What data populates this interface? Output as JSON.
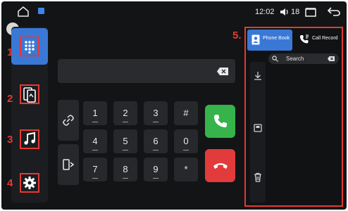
{
  "status_bar": {
    "time": "12:02",
    "volume": "18"
  },
  "callouts": [
    "1",
    "2",
    "3",
    "4",
    "5."
  ],
  "sidebar": {
    "items": [
      {
        "id": "dialpad",
        "icon": "dialpad-icon",
        "active": true
      },
      {
        "id": "phone-link",
        "icon": "phone-link-icon",
        "active": false
      },
      {
        "id": "music",
        "icon": "music-note-icon",
        "active": false
      },
      {
        "id": "settings",
        "icon": "gear-icon",
        "active": false
      }
    ]
  },
  "dialer": {
    "display_value": "",
    "keys": [
      "1",
      "2",
      "3",
      "#",
      "4",
      "5",
      "6",
      "0",
      "7",
      "8",
      "9",
      "*"
    ],
    "utility": [
      "link-icon",
      "phone-transfer-icon"
    ],
    "call_color": "#36b34b",
    "end_color": "#e23b3b"
  },
  "contacts_panel": {
    "tabs": [
      {
        "label": "Phone Book",
        "icon": "contact-book-icon",
        "active": true
      },
      {
        "label": "Call Record",
        "icon": "call-record-icon",
        "active": false
      }
    ],
    "search": {
      "placeholder": "Search"
    },
    "rail": [
      "download-icon",
      "save-icon",
      "trash-icon"
    ]
  },
  "colors": {
    "accent": "#3a78d6",
    "callout": "#e53935",
    "background": "#131416"
  }
}
